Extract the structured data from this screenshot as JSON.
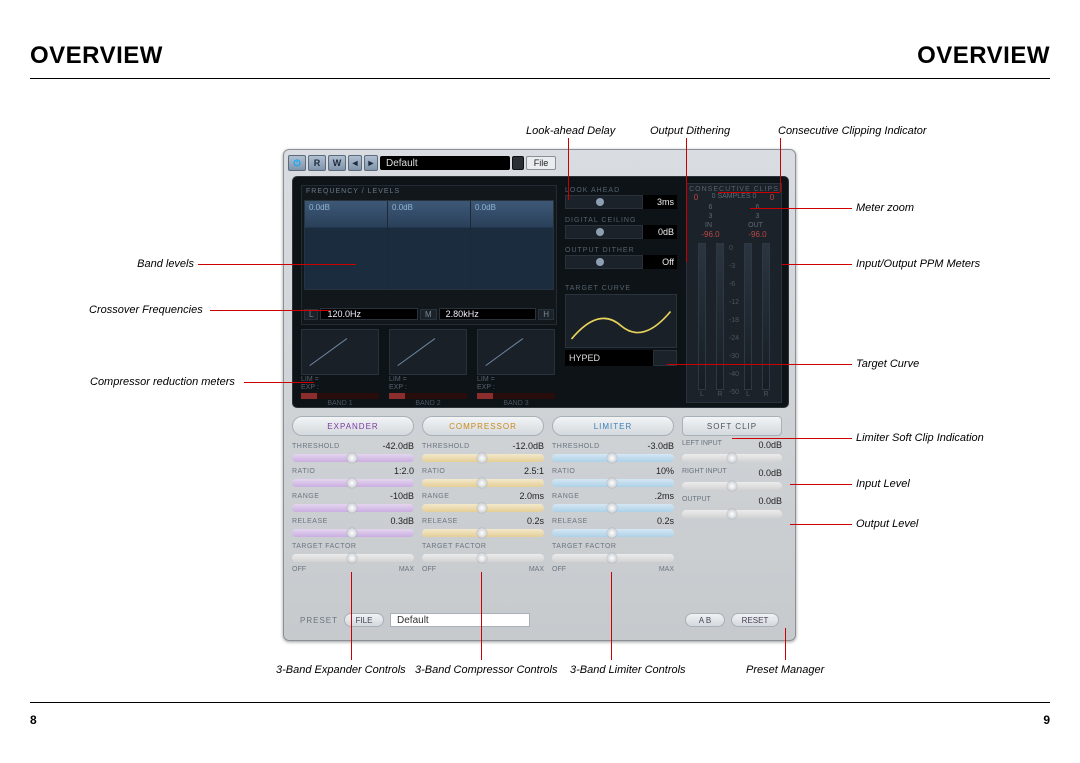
{
  "page": {
    "title_left": "OVERVIEW",
    "title_right": "OVERVIEW",
    "num_left": "8",
    "num_right": "9"
  },
  "callouts": {
    "look_ahead": "Look-ahead Delay",
    "output_dither": "Output Dithering",
    "clip_indicator": "Consecutive Clipping Indicator",
    "meter_zoom": "Meter zoom",
    "io_meters": "Input/Output PPM Meters",
    "target_curve": "Target Curve",
    "soft_clip": "Limiter Soft Clip Indication",
    "input_level": "Input Level",
    "output_level": "Output Level",
    "band_levels": "Band levels",
    "crossover": "Crossover Frequencies",
    "comp_reduction": "Compressor reduction meters",
    "exp_controls": "3-Band Expander Controls",
    "comp_controls": "3-Band Compressor Controls",
    "lim_controls": "3-Band Limiter Controls",
    "preset_mgr": "Preset Manager"
  },
  "toolbar": {
    "r": "R",
    "w": "W",
    "preset": "Default",
    "file": "File"
  },
  "freq_levels": {
    "title": "FREQUENCY / LEVELS",
    "bands": [
      "0.0dB",
      "0.0dB",
      "0.0dB"
    ],
    "xover": {
      "L": "L",
      "v1": "120.0Hz",
      "M": "M",
      "v2": "2.80kHz",
      "H": "H"
    }
  },
  "right_stack": {
    "look_ahead": {
      "label": "LOOK AHEAD",
      "value": "3ms"
    },
    "ceiling": {
      "label": "DIGITAL CEILING",
      "value": "0dB"
    },
    "dither": {
      "label": "OUTPUT DITHER",
      "value": "Off"
    }
  },
  "target_curve": {
    "label": "TARGET CURVE",
    "preset": "HYPED"
  },
  "meters": {
    "clips_label": "CONSECUTIVE CLIPS",
    "clip_l": "0",
    "clip_samp": "0 SAMPLES 0",
    "clip_r": "0",
    "zoom": [
      "6",
      "6"
    ],
    "zoom2": [
      "3",
      "3"
    ],
    "in_label": "IN",
    "out_label": "OUT",
    "in_val": "-96.0",
    "out_val": "-96.0",
    "scale": [
      "0",
      "-3",
      "-6",
      "-12",
      "-18",
      "-24",
      "-30",
      "-40",
      "-50"
    ],
    "lr": "L   R"
  },
  "comp_graphs": {
    "lim": "LIM =",
    "exp": "EXP :",
    "bands": [
      "BAND 1",
      "BAND 2",
      "BAND 3"
    ]
  },
  "expander": {
    "title": "EXPANDER",
    "threshold": {
      "label": "THRESHOLD",
      "value": "-42.0dB"
    },
    "ratio": {
      "label": "RATIO",
      "value": "1:2.0"
    },
    "range": {
      "label": "RANGE",
      "value": "-10dB"
    },
    "release": {
      "label": "RELEASE",
      "value": "0.3dB"
    },
    "target": {
      "label": "TARGET FACTOR",
      "off": "OFF",
      "max": "MAX"
    }
  },
  "compressor": {
    "title": "COMPRESSOR",
    "threshold": {
      "label": "THRESHOLD",
      "value": "-12.0dB"
    },
    "ratio": {
      "label": "RATIO",
      "value": "2.5:1"
    },
    "range": {
      "label": "RANGE",
      "value": "2.0ms"
    },
    "release": {
      "label": "RELEASE",
      "value": "0.2s"
    },
    "target": {
      "label": "TARGET FACTOR",
      "off": "OFF",
      "max": "MAX"
    }
  },
  "limiter": {
    "title": "LIMITER",
    "threshold": {
      "label": "THRESHOLD",
      "value": "-3.0dB"
    },
    "ratio": {
      "label": "RATIO",
      "value": "10%"
    },
    "range": {
      "label": "RANGE",
      "value": ".2ms"
    },
    "release": {
      "label": "RELEASE",
      "value": "0.2s"
    },
    "target": {
      "label": "TARGET FACTOR",
      "off": "OFF",
      "max": "MAX"
    }
  },
  "levels": {
    "softclip": "SOFT CLIP",
    "left": {
      "label": "LEFT INPUT",
      "value": "0.0dB"
    },
    "right": {
      "label": "RIGHT INPUT",
      "value": "0.0dB"
    },
    "output": {
      "label": "OUTPUT",
      "value": "0.0dB"
    }
  },
  "preset_bar": {
    "label": "PRESET",
    "file": "FILE",
    "name": "Default",
    "ab": "A   B",
    "reset": "RESET"
  }
}
